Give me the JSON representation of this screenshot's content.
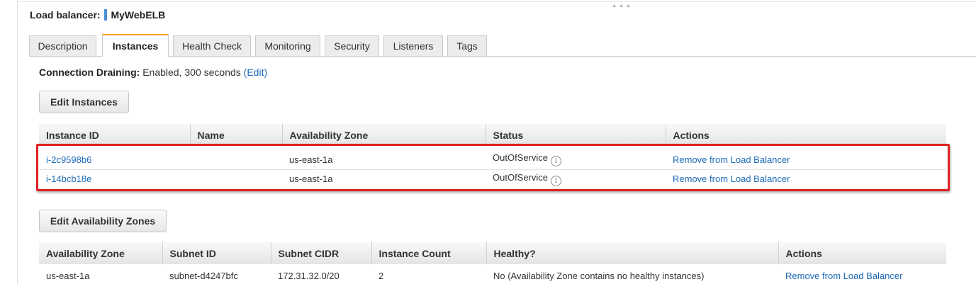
{
  "header": {
    "label": "Load balancer:",
    "name": "MyWebELB"
  },
  "tabs": [
    "Description",
    "Instances",
    "Health Check",
    "Monitoring",
    "Security",
    "Listeners",
    "Tags"
  ],
  "active_tab": "Instances",
  "connection_draining": {
    "label": "Connection Draining:",
    "value": "Enabled, 300 seconds",
    "edit_link": "(Edit)"
  },
  "buttons": {
    "edit_instances": "Edit Instances",
    "edit_zones": "Edit Availability Zones"
  },
  "instances_table": {
    "headers": [
      "Instance ID",
      "Name",
      "Availability Zone",
      "Status",
      "Actions"
    ],
    "rows": [
      {
        "id": "i-2c9598b6",
        "name": "",
        "zone": "us-east-1a",
        "status": "OutOfService",
        "action": "Remove from Load Balancer"
      },
      {
        "id": "i-14bcb18e",
        "name": "",
        "zone": "us-east-1a",
        "status": "OutOfService",
        "action": "Remove from Load Balancer"
      }
    ]
  },
  "zones_table": {
    "headers": [
      "Availability Zone",
      "Subnet ID",
      "Subnet CIDR",
      "Instance Count",
      "Healthy?",
      "Actions"
    ],
    "rows": [
      {
        "zone": "us-east-1a",
        "subnet": "subnet-d4247bfc",
        "cidr": "172.31.32.0/20",
        "count": "2",
        "healthy": "No (Availability Zone contains no healthy instances)",
        "action": "Remove from Load Balancer"
      }
    ]
  },
  "colors": {
    "link": "#1e6bb8",
    "active_tab_accent": "#f0a030",
    "highlight": "#e02020",
    "brand_bar": "#4a90d9"
  },
  "icons": {
    "status_info": "info-icon",
    "resize_grip": "drag-handle-icon"
  }
}
